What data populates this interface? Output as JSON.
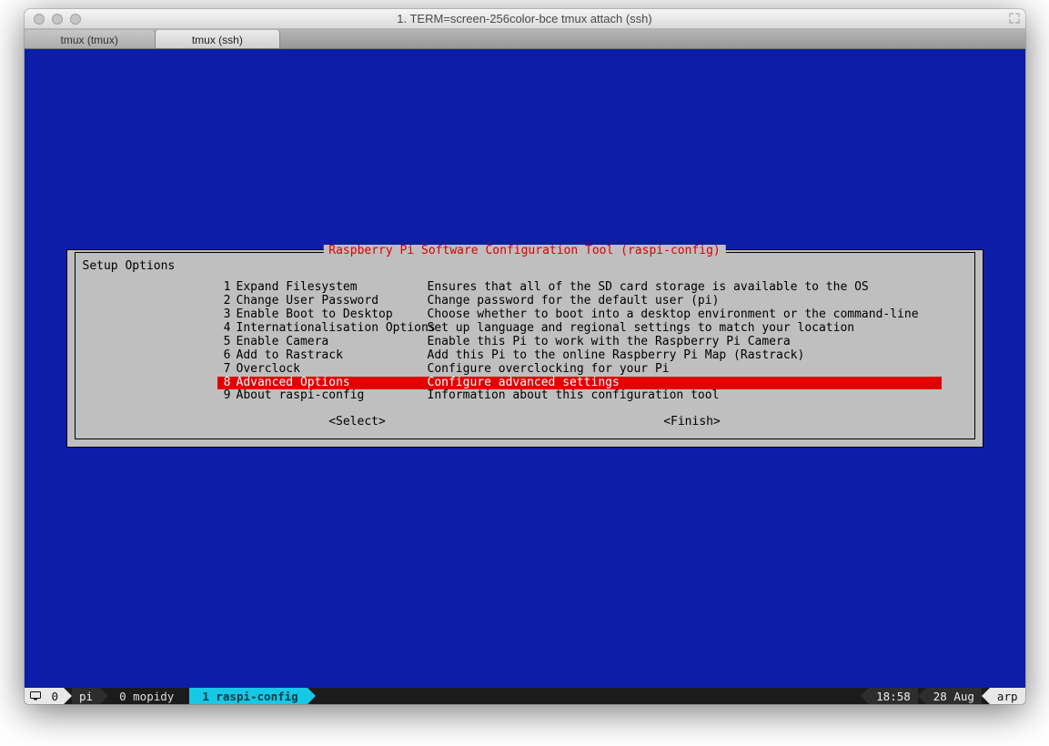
{
  "window": {
    "title": "1. TERM=screen-256color-bce tmux attach (ssh)"
  },
  "tabs": [
    {
      "label": "tmux (tmux)",
      "active": false
    },
    {
      "label": "tmux (ssh)",
      "active": true
    }
  ],
  "dialog": {
    "title": "Raspberry Pi Software Configuration Tool (raspi-config)",
    "setup_label": "Setup Options",
    "selected_index": 7,
    "items": [
      {
        "num": "1",
        "label": "Expand Filesystem",
        "desc": "Ensures that all of the SD card storage is available to the OS"
      },
      {
        "num": "2",
        "label": "Change User Password",
        "desc": "Change password for the default user (pi)"
      },
      {
        "num": "3",
        "label": "Enable Boot to Desktop",
        "desc": "Choose whether to boot into a desktop environment or the command-line"
      },
      {
        "num": "4",
        "label": "Internationalisation Options",
        "desc": "Set up language and regional settings to match your location"
      },
      {
        "num": "5",
        "label": "Enable Camera",
        "desc": "Enable this Pi to work with the Raspberry Pi Camera"
      },
      {
        "num": "6",
        "label": "Add to Rastrack",
        "desc": "Add this Pi to the online Raspberry Pi Map (Rastrack)"
      },
      {
        "num": "7",
        "label": "Overclock",
        "desc": "Configure overclocking for your Pi"
      },
      {
        "num": "8",
        "label": "Advanced Options",
        "desc": "Configure advanced settings"
      },
      {
        "num": "9",
        "label": "About raspi-config",
        "desc": "Information about this configuration tool"
      }
    ],
    "buttons": {
      "select": "<Select>",
      "finish": "<Finish>"
    }
  },
  "statusbar": {
    "session_index": "0",
    "host_user": "pi",
    "window_inactive": "0 mopidy",
    "window_active": "1  raspi-config",
    "time": "18:58",
    "date": "28 Aug",
    "host": "arp"
  }
}
